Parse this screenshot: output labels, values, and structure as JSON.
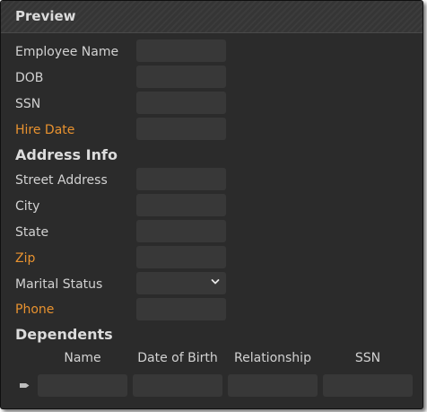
{
  "panel": {
    "title": "Preview"
  },
  "colors": {
    "background": "#2b2b2b",
    "field": "#383838",
    "text": "#d2d2d2",
    "required_label": "#e8922f"
  },
  "fields": [
    {
      "label": "Employee Name",
      "value": "",
      "required": false
    },
    {
      "label": "DOB",
      "value": "",
      "required": false
    },
    {
      "label": "SSN",
      "value": "",
      "required": false
    },
    {
      "label": "Hire Date",
      "value": "",
      "required": true
    }
  ],
  "address": {
    "heading": "Address Info",
    "fields": [
      {
        "label": "Street Address",
        "value": "",
        "required": false
      },
      {
        "label": "City",
        "value": "",
        "required": false
      },
      {
        "label": "State",
        "value": "",
        "required": false
      },
      {
        "label": "Zip",
        "value": "",
        "required": true
      }
    ]
  },
  "marital": {
    "label": "Marital Status",
    "selected": ""
  },
  "phone": {
    "label": "Phone",
    "value": "",
    "required": true
  },
  "dependents": {
    "heading": "Dependents",
    "columns": [
      "Name",
      "Date of Birth",
      "Relationship",
      "SSN"
    ],
    "new_row": [
      "",
      "",
      "",
      ""
    ]
  }
}
